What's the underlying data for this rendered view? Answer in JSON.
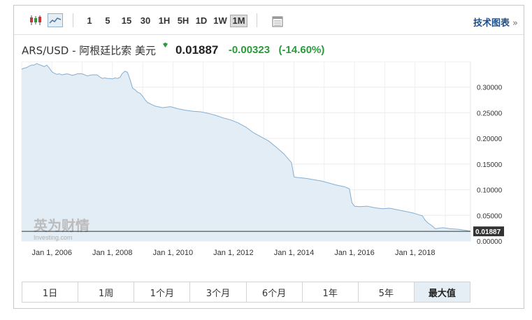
{
  "toolbar": {
    "chart_type_icons": [
      "candlestick-icon",
      "line-chart-icon"
    ],
    "timeframes": [
      {
        "label": "1",
        "active": false
      },
      {
        "label": "5",
        "active": false
      },
      {
        "label": "15",
        "active": false
      },
      {
        "label": "30",
        "active": false
      },
      {
        "label": "1H",
        "active": false
      },
      {
        "label": "5H",
        "active": false
      },
      {
        "label": "1D",
        "active": false
      },
      {
        "label": "1W",
        "active": false
      },
      {
        "label": "1M",
        "active": true
      }
    ],
    "table_icon": "table-icon",
    "tech_chart_link": "技术图表",
    "tech_chart_arrow": "»"
  },
  "quote": {
    "name": "ARS/USD - 阿根廷比索 美元",
    "price": "0.01887",
    "change": "-0.00323",
    "change_pct": "(-14.60%)",
    "change_color": "#2a9a3a",
    "dot_color": "#2a9a3a"
  },
  "watermark": {
    "cn": "英为财情",
    "en": "Investing.com"
  },
  "chart_data": {
    "type": "area",
    "x": [
      "2005-01",
      "2005-02",
      "2005-03",
      "2005-04",
      "2005-05",
      "2005-06",
      "2005-07",
      "2005-08",
      "2005-09",
      "2005-10",
      "2005-11",
      "2005-12",
      "2006-01",
      "2006-02",
      "2006-03",
      "2006-04",
      "2006-05",
      "2006-06",
      "2006-07",
      "2006-08",
      "2006-09",
      "2006-10",
      "2006-11",
      "2006-12",
      "2007-01",
      "2007-02",
      "2007-03",
      "2007-04",
      "2007-05",
      "2007-06",
      "2007-07",
      "2007-08",
      "2007-09",
      "2007-10",
      "2007-11",
      "2007-12",
      "2008-01",
      "2008-02",
      "2008-03",
      "2008-04",
      "2008-05",
      "2008-06",
      "2008-07",
      "2008-08",
      "2008-09",
      "2008-10",
      "2008-11",
      "2008-12",
      "2009-01",
      "2009-02",
      "2009-03",
      "2009-06",
      "2009-09",
      "2009-12",
      "2010-03",
      "2010-06",
      "2010-09",
      "2010-12",
      "2011-03",
      "2011-06",
      "2011-09",
      "2011-12",
      "2012-03",
      "2012-06",
      "2012-09",
      "2012-12",
      "2013-03",
      "2013-06",
      "2013-09",
      "2013-12",
      "2014-01",
      "2014-02",
      "2014-06",
      "2014-12",
      "2015-03",
      "2015-06",
      "2015-09",
      "2015-11",
      "2015-12",
      "2016-01",
      "2016-03",
      "2016-06",
      "2016-09",
      "2016-12",
      "2017-03",
      "2017-06",
      "2017-09",
      "2017-12",
      "2018-02",
      "2018-04",
      "2018-05",
      "2018-06",
      "2018-08",
      "2018-09",
      "2018-12",
      "2019-03",
      "2019-06",
      "2019-09",
      "2019-11"
    ],
    "series": [
      {
        "values": [
          0.335,
          0.337,
          0.338,
          0.341,
          0.343,
          0.343,
          0.346,
          0.344,
          0.342,
          0.34,
          0.343,
          0.337,
          0.33,
          0.327,
          0.325,
          0.326,
          0.324,
          0.325,
          0.326,
          0.325,
          0.323,
          0.324,
          0.326,
          0.326,
          0.326,
          0.324,
          0.322,
          0.323,
          0.324,
          0.324,
          0.324,
          0.32,
          0.317,
          0.318,
          0.317,
          0.317,
          0.316,
          0.318,
          0.317,
          0.319,
          0.327,
          0.331,
          0.329,
          0.315,
          0.298,
          0.295,
          0.29,
          0.288,
          0.282,
          0.275,
          0.27,
          0.263,
          0.26,
          0.262,
          0.258,
          0.255,
          0.253,
          0.252,
          0.249,
          0.245,
          0.24,
          0.236,
          0.23,
          0.222,
          0.211,
          0.203,
          0.195,
          0.183,
          0.17,
          0.153,
          0.125,
          0.124,
          0.122,
          0.117,
          0.113,
          0.109,
          0.106,
          0.102,
          0.075,
          0.068,
          0.067,
          0.068,
          0.065,
          0.063,
          0.064,
          0.061,
          0.058,
          0.055,
          0.052,
          0.049,
          0.041,
          0.036,
          0.029,
          0.024,
          0.026,
          0.024,
          0.023,
          0.021,
          0.019
        ]
      }
    ],
    "x_tick_labels": [
      "Jan 1, 2006",
      "Jan 1, 2008",
      "Jan 1, 2010",
      "Jan 1, 2012",
      "Jan 1, 2014",
      "Jan 1, 2016",
      "Jan 1, 2018"
    ],
    "y_ticks": [
      0.0,
      0.05,
      0.1,
      0.15,
      0.2,
      0.25,
      0.3
    ],
    "y_tick_labels": [
      "0.00000",
      "0.05000",
      "0.10000",
      "0.15000",
      "0.20000",
      "0.25000",
      "0.30000"
    ],
    "ylim": [
      0.0,
      0.35
    ],
    "last_value": 0.01887,
    "last_value_label": "0.01887",
    "line_color": "#86aed0",
    "fill_color": "#e3edf5",
    "grid": true
  },
  "ranges": [
    {
      "label": "1日",
      "active": false
    },
    {
      "label": "1周",
      "active": false
    },
    {
      "label": "1个月",
      "active": false
    },
    {
      "label": "3个月",
      "active": false
    },
    {
      "label": "6个月",
      "active": false
    },
    {
      "label": "1年",
      "active": false
    },
    {
      "label": "5年",
      "active": false
    },
    {
      "label": "最大值",
      "active": true
    }
  ]
}
